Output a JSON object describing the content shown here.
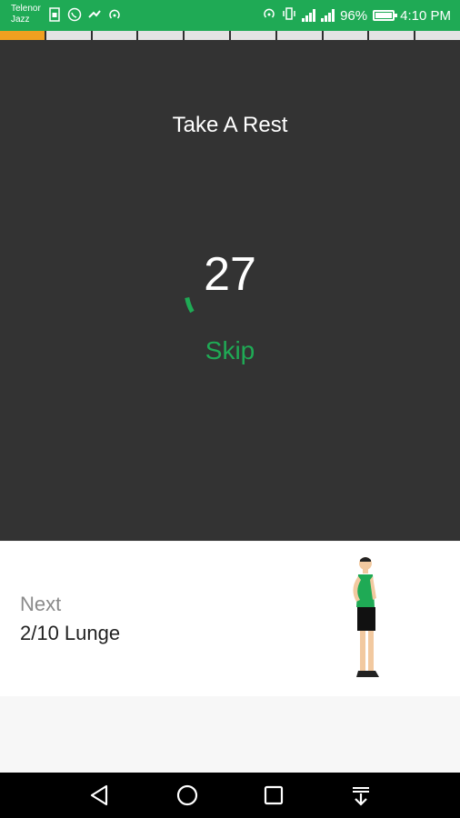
{
  "status_bar": {
    "carrier_line1": "Telenor",
    "carrier_line2": "Jazz",
    "battery_percent": "96%",
    "time": "4:10 PM",
    "network1": "3G",
    "network2": "2G",
    "bg_color": "#1faa55"
  },
  "progress": {
    "total_segments": 10,
    "current_segment": 1,
    "active_color": "#f0a020",
    "inactive_color": "#e3e3e3"
  },
  "rest": {
    "title": "Take A Rest",
    "countdown": "27",
    "countdown_progress": 0.1,
    "skip_label": "Skip",
    "accent_color": "#1faa55"
  },
  "next": {
    "label": "Next",
    "exercise": "2/10 Lunge"
  },
  "nav": {
    "back_icon": "triangle-back-icon",
    "home_icon": "circle-home-icon",
    "recents_icon": "square-recents-icon",
    "menu_icon": "down-arrow-menu-icon"
  }
}
